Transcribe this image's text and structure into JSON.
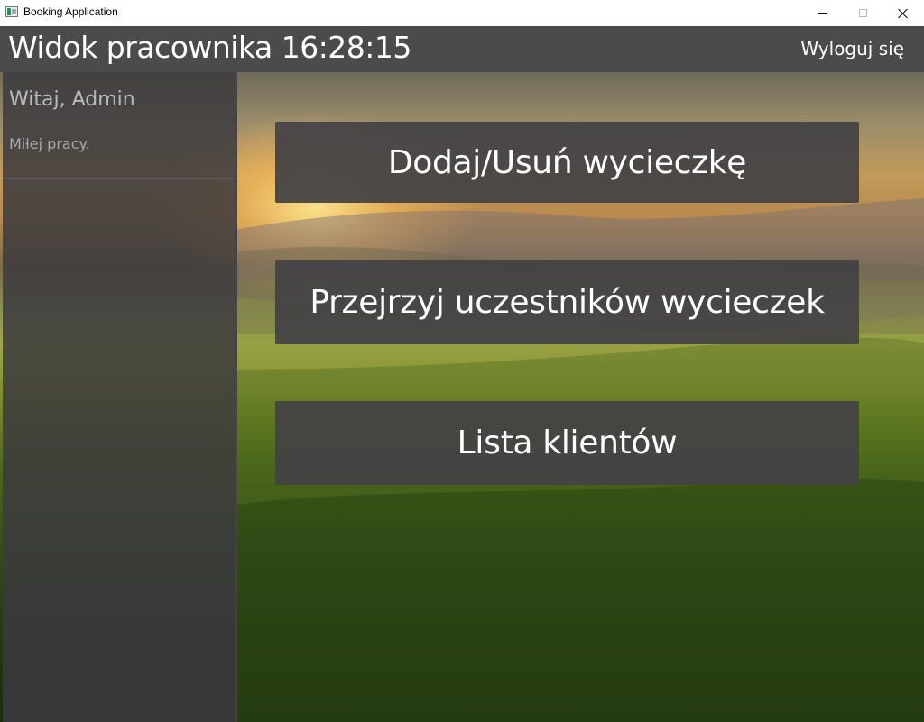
{
  "window": {
    "title": "Booking Application",
    "controls": [
      "minimize",
      "maximize",
      "close"
    ]
  },
  "header": {
    "title": "Widok pracownika 16:28:15",
    "logout_label": "Wyloguj się"
  },
  "sidebar": {
    "greeting": "Witaj, Admin",
    "subtext": "Miłej pracy."
  },
  "actions": {
    "manage_trips_label": "Dodaj/Usuń wycieczkę",
    "view_participants_label": "Przejrzyj uczestników wycieczek",
    "client_list_label": "Lista klientów"
  },
  "colors": {
    "header_bg": "#4b4a4d",
    "button_bg": "#444245",
    "text_primary": "#ffffff"
  }
}
